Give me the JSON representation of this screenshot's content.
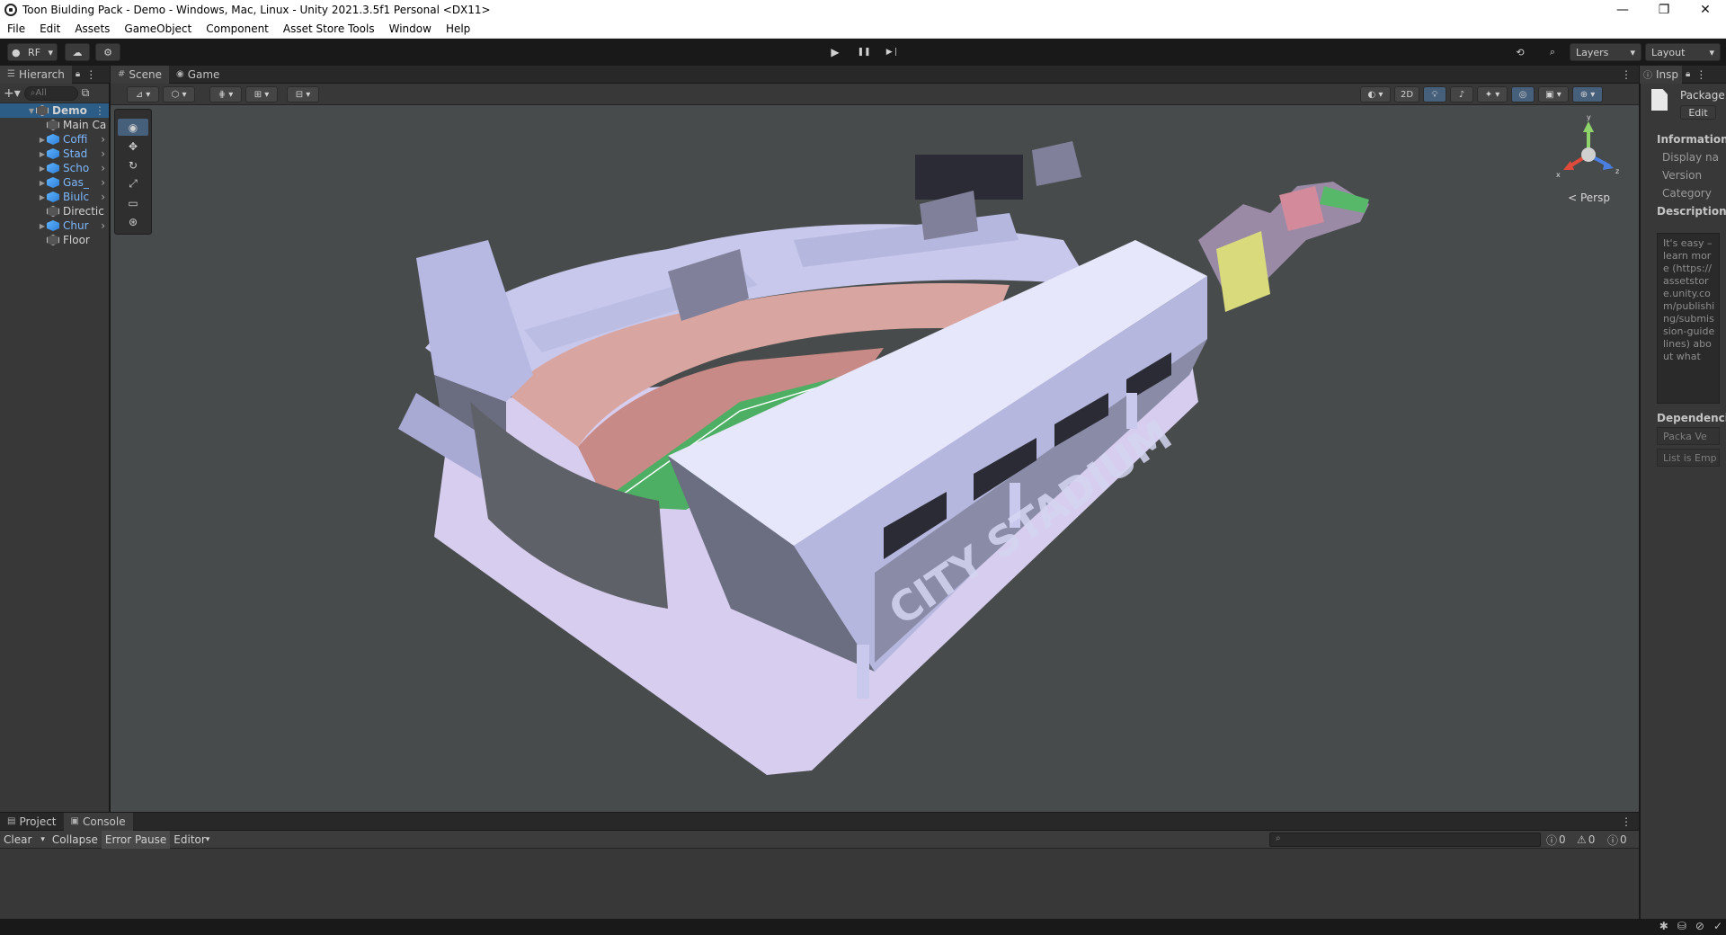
{
  "window": {
    "title": "Toon Biulding Pack - Demo - Windows, Mac, Linux - Unity 2021.3.5f1 Personal <DX11>",
    "minimize": "—",
    "maximize": "❐",
    "close": "✕"
  },
  "menu": [
    "File",
    "Edit",
    "Assets",
    "GameObject",
    "Component",
    "Asset Store Tools",
    "Window",
    "Help"
  ],
  "toolbar": {
    "account_label": "RF",
    "layers_label": "Layers",
    "layout_label": "Layout",
    "play_icon": "▶",
    "pause_icon": "❚❚",
    "step_icon": "▶❘"
  },
  "hierarchy": {
    "tab_label": "Hierarch",
    "search_placeholder": "All",
    "scene_name": "Demo",
    "items": [
      {
        "label": "Main Ca",
        "icon": "gameobject",
        "prefab": false,
        "expandable": false
      },
      {
        "label": "Coffi",
        "icon": "prefab-cube",
        "prefab": true,
        "expandable": true
      },
      {
        "label": "Stad",
        "icon": "prefab-cube",
        "prefab": true,
        "expandable": true
      },
      {
        "label": "Scho",
        "icon": "prefab-cube",
        "prefab": true,
        "expandable": true
      },
      {
        "label": "Gas_",
        "icon": "prefab-cube",
        "prefab": true,
        "expandable": true
      },
      {
        "label": "Biulc",
        "icon": "prefab-cube",
        "prefab": true,
        "expandable": true
      },
      {
        "label": "Directic",
        "icon": "gameobject",
        "prefab": false,
        "expandable": false
      },
      {
        "label": "Chur",
        "icon": "prefab-cube",
        "prefab": true,
        "expandable": true
      },
      {
        "label": "Floor",
        "icon": "gameobject",
        "prefab": false,
        "expandable": false
      }
    ]
  },
  "scene": {
    "tabs": [
      {
        "label": "Scene",
        "icon": "#",
        "active": true
      },
      {
        "label": "Game",
        "icon": "◉",
        "active": false
      }
    ],
    "mode_2d": "2D",
    "persp_label": "< Persp",
    "gizmo_axes": {
      "y": "y",
      "x": "x",
      "z": "z"
    },
    "stadium_sign": "CITY STADIUM"
  },
  "inspector": {
    "tab_label": "Insp",
    "title": "Package",
    "edit_button": "Edit",
    "information_label": "Information",
    "fields": [
      "Display na",
      "Version",
      "Category"
    ],
    "description_label": "Description",
    "description_text": "It's easy – learn more (https://assetstore.unity.com/publishing/submission-guidelines) about what",
    "dependencies_label": "Dependencie",
    "dep_columns": "Packa  Ve",
    "dep_empty": "List is Emp"
  },
  "console": {
    "tabs": [
      {
        "label": "Project",
        "active": false
      },
      {
        "label": "Console",
        "active": true
      }
    ],
    "clear_label": "Clear",
    "collapse_label": "Collapse",
    "error_pause_label": "Error Pause",
    "editor_label": "Editor",
    "log_count": "0",
    "warn_count": "0",
    "error_count": "0"
  },
  "colors": {
    "editor_bg": "#383838",
    "viewport_bg": "#474b4b",
    "prefab_blue": "#7cb7ff",
    "stadium_wall": "#c9c9ee",
    "field_green": "#4caf63"
  }
}
